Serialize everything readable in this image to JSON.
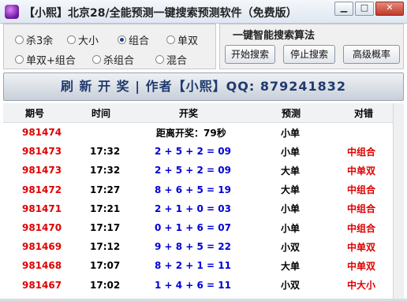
{
  "window": {
    "title": "【小熙】北京28/全能预测一键搜索预测软件（免费版）",
    "min_glyph": "▁",
    "max_glyph": "□",
    "close_glyph": "✕"
  },
  "options": {
    "row1": [
      {
        "label": "杀3余",
        "checked": false
      },
      {
        "label": "大小",
        "checked": false
      },
      {
        "label": "组合",
        "checked": true
      },
      {
        "label": "单双",
        "checked": false
      }
    ],
    "row2": [
      {
        "label": "单双+组合",
        "checked": false
      },
      {
        "label": "杀组合",
        "checked": false
      },
      {
        "label": "混合",
        "checked": false
      }
    ]
  },
  "search": {
    "group_title": "一键智能搜索算法",
    "start_label": "开始搜索",
    "stop_label": "停止搜索",
    "advanced_label": "高级概率"
  },
  "banner": {
    "text": "刷 新 开 奖 | 作者【小熙】QQ: 879241832"
  },
  "table": {
    "headers": [
      "期号",
      "时间",
      "开奖",
      "预测",
      "对错"
    ],
    "rows": [
      {
        "period": "981474",
        "time": "",
        "result": "距离开奖：79秒",
        "predict": "小单",
        "verdict": ""
      },
      {
        "period": "981473",
        "time": "17:32",
        "result": "2 + 5 + 2 = 09",
        "predict": "小单",
        "verdict": "中组合"
      },
      {
        "period": "981473",
        "time": "17:32",
        "result": "2 + 5 + 2 = 09",
        "predict": "大单",
        "verdict": "中单双"
      },
      {
        "period": "981472",
        "time": "17:27",
        "result": "8 + 6 + 5 = 19",
        "predict": "大单",
        "verdict": "中组合"
      },
      {
        "period": "981471",
        "time": "17:21",
        "result": "2 + 1 + 0 = 03",
        "predict": "小单",
        "verdict": "中组合"
      },
      {
        "period": "981470",
        "time": "17:17",
        "result": "0 + 1 + 6 = 07",
        "predict": "小单",
        "verdict": "中组合"
      },
      {
        "period": "981469",
        "time": "17:12",
        "result": "9 + 8 + 5 = 22",
        "predict": "小双",
        "verdict": "中单双"
      },
      {
        "period": "981468",
        "time": "17:07",
        "result": "8 + 2 + 1 = 11",
        "predict": "大单",
        "verdict": "中单双"
      },
      {
        "period": "981467",
        "time": "17:02",
        "result": "1 + 4 + 6 = 11",
        "predict": "小双",
        "verdict": "中大小"
      }
    ]
  },
  "colors": {
    "period": "#e00000",
    "result": "#0000d8",
    "verdict": "#e00000",
    "banner_text": "#1f3a6e"
  }
}
